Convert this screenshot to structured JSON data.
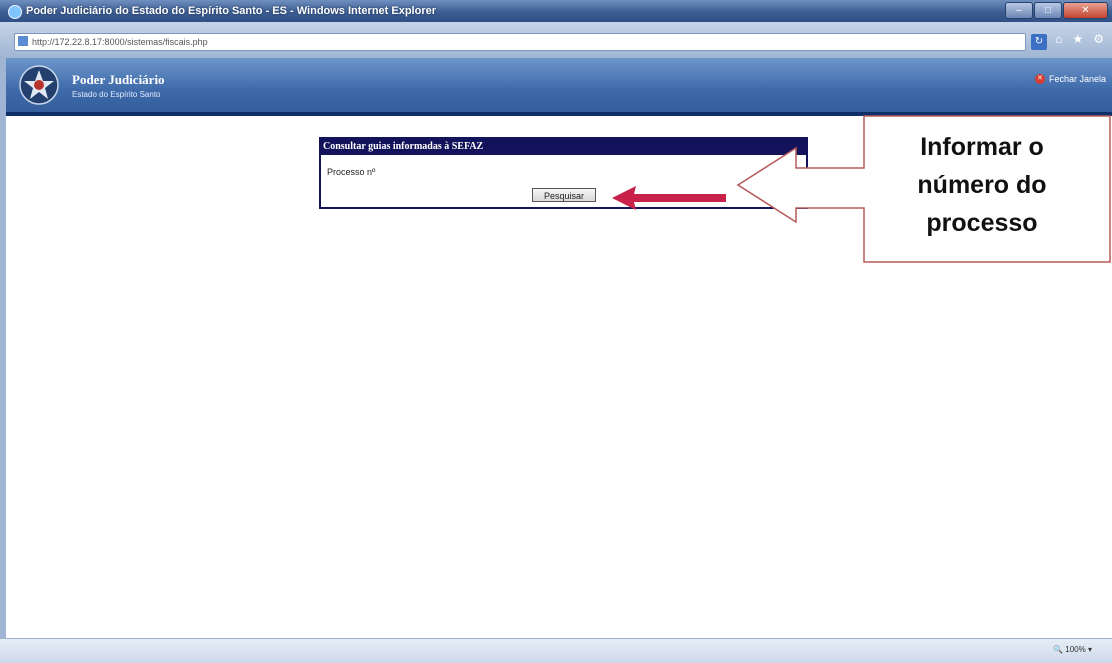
{
  "browser": {
    "window_title": "Poder Judiciário do Estado do Espírito Santo - ES - Windows Internet Explorer",
    "address": "http://172.22.8.17:8000/sistemas/fiscais.php",
    "zoom": "100%"
  },
  "banner": {
    "title": "Poder Judiciário",
    "subtitle": "Estado do Espírito Santo",
    "close_label": "Fechar Janela"
  },
  "panel": {
    "header": "Consultar guias informadas à SEFAZ",
    "label": "Processo nº",
    "button_label": "Pesquisar"
  },
  "callout": {
    "line1": "Informar o",
    "line2": "número do",
    "line3": "processo"
  },
  "colors": {
    "panel_header": "#12135a",
    "banner": "#3e6aa9",
    "arrow": "#c8214a",
    "callout_border": "#b85a5a"
  }
}
